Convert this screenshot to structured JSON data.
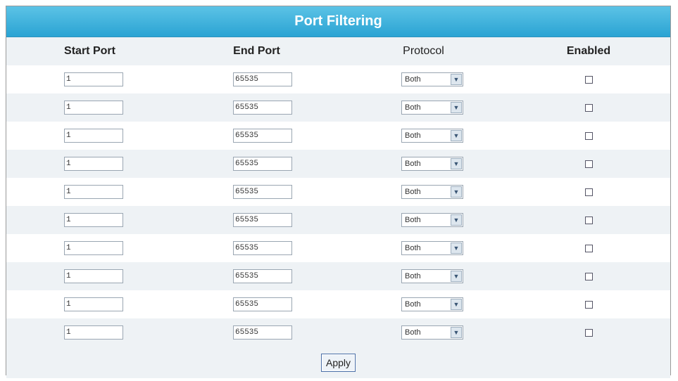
{
  "title": "Port Filtering",
  "columns": {
    "start_port": "Start Port",
    "end_port": "End Port",
    "protocol": "Protocol",
    "enabled": "Enabled"
  },
  "rows": [
    {
      "start": "1",
      "end": "65535",
      "protocol": "Both",
      "enabled": false
    },
    {
      "start": "1",
      "end": "65535",
      "protocol": "Both",
      "enabled": false
    },
    {
      "start": "1",
      "end": "65535",
      "protocol": "Both",
      "enabled": false
    },
    {
      "start": "1",
      "end": "65535",
      "protocol": "Both",
      "enabled": false
    },
    {
      "start": "1",
      "end": "65535",
      "protocol": "Both",
      "enabled": false
    },
    {
      "start": "1",
      "end": "65535",
      "protocol": "Both",
      "enabled": false
    },
    {
      "start": "1",
      "end": "65535",
      "protocol": "Both",
      "enabled": false
    },
    {
      "start": "1",
      "end": "65535",
      "protocol": "Both",
      "enabled": false
    },
    {
      "start": "1",
      "end": "65535",
      "protocol": "Both",
      "enabled": false
    },
    {
      "start": "1",
      "end": "65535",
      "protocol": "Both",
      "enabled": false
    }
  ],
  "apply_label": "Apply",
  "colors": {
    "title_bar": "#2aa3d3",
    "row_alt": "#eef2f5"
  }
}
